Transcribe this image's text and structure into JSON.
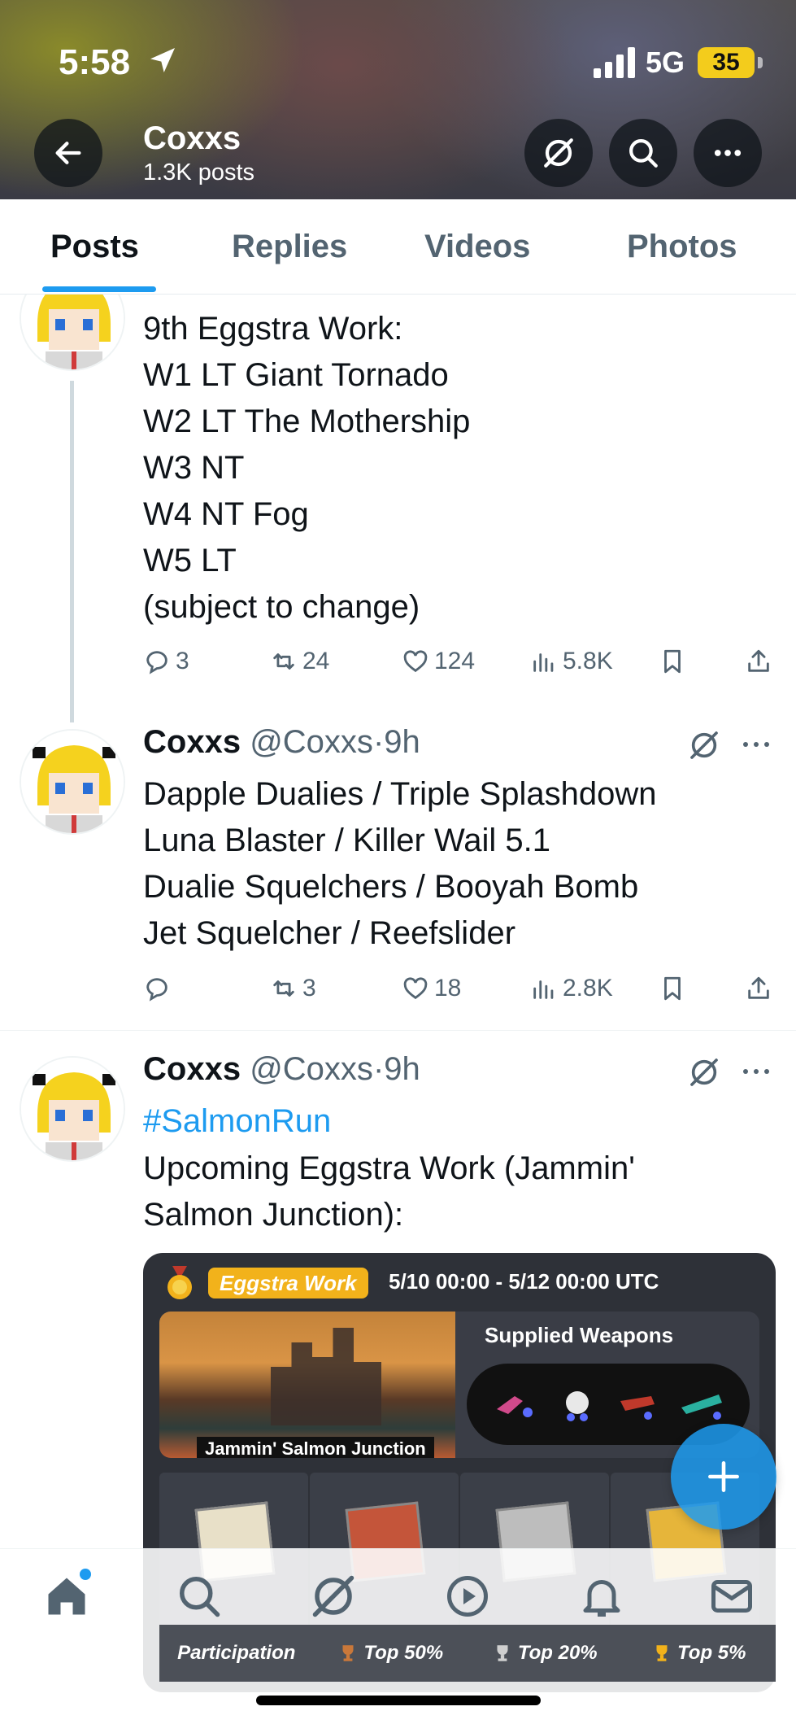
{
  "status_bar": {
    "time": "5:58",
    "network": "5G",
    "battery": "35"
  },
  "profile_header": {
    "name": "Coxxs",
    "posts_count": "1.3K posts"
  },
  "tabs": [
    {
      "label": "Posts",
      "active": true
    },
    {
      "label": "Replies",
      "active": false
    },
    {
      "label": "Videos",
      "active": false
    },
    {
      "label": "Photos",
      "active": false
    }
  ],
  "tweets": [
    {
      "text": "9th Eggstra Work:\nW1 LT Giant Tornado\nW2 LT The Mothership\nW3 NT\nW4 NT Fog\nW5 LT\n(subject to change)",
      "replies": "3",
      "reposts": "24",
      "likes": "124",
      "views": "5.8K"
    },
    {
      "name": "Coxxs",
      "handle": "@Coxxs",
      "dot": "·",
      "time": "9h",
      "text": "Dapple Dualies / Triple Splashdown\nLuna Blaster / Killer Wail 5.1\nDualie Squelchers / Booyah Bomb\nJet Squelcher / Reefslider",
      "replies": "",
      "reposts": "3",
      "likes": "18",
      "views": "2.8K"
    },
    {
      "name": "Coxxs",
      "handle": "@Coxxs",
      "dot": "·",
      "time": "9h",
      "hashtag": "#SalmonRun",
      "text": "Upcoming Eggstra Work (Jammin'\nSalmon Junction):",
      "card": {
        "badge": "Eggstra Work",
        "date_range": "5/10 00:00 - 5/12 00:00 UTC",
        "stage": "Jammin' Salmon Junction",
        "supplied_title": "Supplied Weapons",
        "rewards": [
          "Participation",
          "Top 50%",
          "Top 20%",
          "Top 5%"
        ]
      }
    }
  ],
  "colors": {
    "accent": "#1d9bf0",
    "muted": "#536471",
    "card_bg": "#2e3138",
    "badge": "#f2b21b"
  }
}
